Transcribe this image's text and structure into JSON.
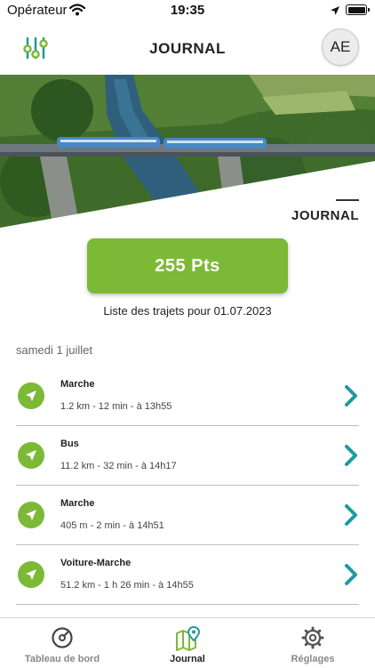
{
  "status_bar": {
    "carrier": "Opérateur",
    "time": "19:35"
  },
  "header": {
    "title": "JOURNAL",
    "avatar_initials": "AE"
  },
  "section": {
    "title": "JOURNAL"
  },
  "points": {
    "label": "255 Pts"
  },
  "list": {
    "subtitle": "Liste des trajets pour 01.07.2023",
    "day": "samedi 1 juillet"
  },
  "trips": [
    {
      "mode": "Marche",
      "detail": "1.2 km - 12 min - à 13h55"
    },
    {
      "mode": "Bus",
      "detail": "11.2 km - 32 min - à 14h17"
    },
    {
      "mode": "Marche",
      "detail": "405 m - 2 min - à 14h51"
    },
    {
      "mode": "Voiture-Marche",
      "detail": "51.2 km - 1 h 26 min - à 14h55"
    }
  ],
  "tabs": [
    {
      "label": "Tableau de bord",
      "icon": "gauge-icon"
    },
    {
      "label": "Journal",
      "icon": "map-pin-icon"
    },
    {
      "label": "Réglages",
      "icon": "gear-icon"
    }
  ],
  "colors": {
    "accent_green": "#7cb936",
    "teal": "#1e9aa0"
  }
}
